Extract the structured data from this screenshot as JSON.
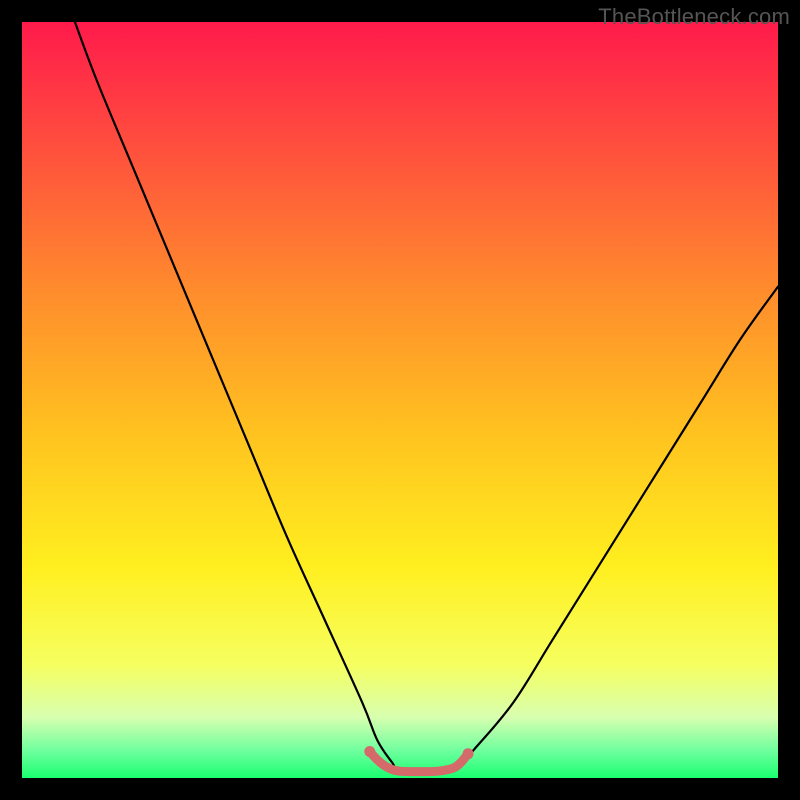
{
  "watermark": "TheBottleneck.com",
  "chart_data": {
    "type": "line",
    "title": "",
    "xlabel": "",
    "ylabel": "",
    "xlim": [
      0,
      100
    ],
    "ylim": [
      0,
      100
    ],
    "grid": false,
    "legend": false,
    "gradient_stops": [
      {
        "offset": 0,
        "color": "#ff1a4b"
      },
      {
        "offset": 0.15,
        "color": "#ff4a3f"
      },
      {
        "offset": 0.35,
        "color": "#ff8a2d"
      },
      {
        "offset": 0.55,
        "color": "#ffc41f"
      },
      {
        "offset": 0.72,
        "color": "#ffef1f"
      },
      {
        "offset": 0.85,
        "color": "#f6ff60"
      },
      {
        "offset": 0.92,
        "color": "#d7ffb0"
      },
      {
        "offset": 0.965,
        "color": "#6cff9d"
      },
      {
        "offset": 1.0,
        "color": "#1aff70"
      }
    ],
    "series": [
      {
        "name": "bottleneck-curve",
        "color": "#000000",
        "x": [
          7,
          10,
          15,
          20,
          25,
          30,
          35,
          40,
          45,
          47,
          49,
          50,
          55,
          58,
          60,
          65,
          70,
          75,
          80,
          85,
          90,
          95,
          100
        ],
        "values": [
          100,
          92,
          80,
          68,
          56,
          44,
          32,
          21,
          10,
          5,
          2,
          1,
          1,
          2,
          4,
          10,
          18,
          26,
          34,
          42,
          50,
          58,
          65
        ]
      },
      {
        "name": "optimal-band",
        "color": "#d46a6a",
        "x": [
          46,
          47,
          48,
          49,
          50,
          51,
          53,
          55,
          57,
          58,
          59
        ],
        "values": [
          3.5,
          2.4,
          1.6,
          1.1,
          0.9,
          0.85,
          0.85,
          0.9,
          1.3,
          2.0,
          3.2
        ]
      }
    ]
  }
}
